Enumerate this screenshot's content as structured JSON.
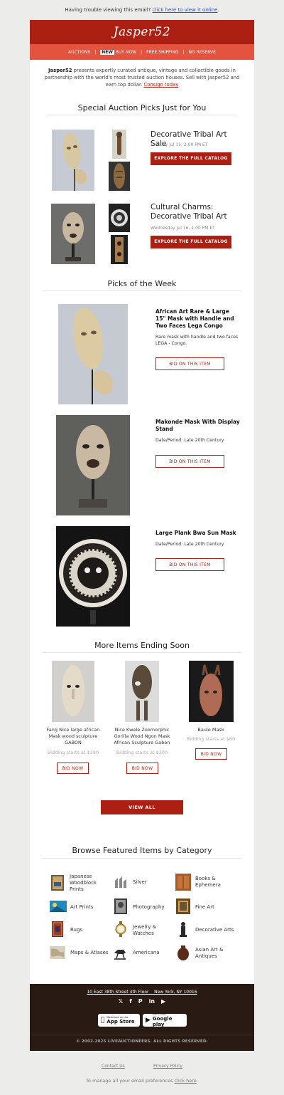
{
  "preheader": {
    "text": "Having trouble viewing this email?",
    "link": "click here to view it online",
    "end": "."
  },
  "header": {
    "logo": "Jasper52"
  },
  "nav": {
    "auctions": "AUCTIONS",
    "sep": "|",
    "new_badge": "NEW",
    "buy_now": "BUY NOW",
    "free_shipping": "FREE SHIPPING",
    "no_reserve": "NO RESERVE"
  },
  "intro": {
    "brand": "Jasper52",
    "text": " presents expertly curated antique, vintage and collectible goods in partnership with the world's most trusted auction houses. Sell with Jasper52 and earn top dollar. ",
    "link": "Consign today"
  },
  "special": {
    "heading": "Special Auction Picks Just for You",
    "sales": [
      {
        "title": "Decorative Tribal Art Sale",
        "date": "Tuesday Jul 15, 2:00 PM ET",
        "button": "EXPLORE THE FULL CATALOG"
      },
      {
        "title": "Cultural Charms: Decorative Tribal Art",
        "date": "Wednesday Jul 16, 1:00 PM ET",
        "button": "EXPLORE THE FULL CATALOG"
      }
    ]
  },
  "picks": {
    "heading": "Picks of the Week",
    "items": [
      {
        "title": "African Art Rare & Large 15\" Mask with Handle and Two Faces Lega Congo",
        "desc": "Rare mask with handle and two faces LEGA - Congo.",
        "button": "BID ON THIS ITEM"
      },
      {
        "title": "Makonde Mask With Display Stand",
        "desc": "Date/Period: Late 20th Century",
        "button": "BID ON THIS ITEM"
      },
      {
        "title": "Large Plank Bwa Sun Mask",
        "desc": "Date/Period: Late 20th Century",
        "button": "BID ON THIS ITEM"
      }
    ]
  },
  "ending": {
    "heading": "More Items Ending Soon",
    "items": [
      {
        "name": "Fang Nice large african Mask wood sculpture GABON",
        "price": "Bidding starts at $180",
        "button": "BID NOW"
      },
      {
        "name": "Nice Kwele Zoomorphic Gorilla Wood Ngon Mask African Sculpture Gabon",
        "price": "Bidding starts at $200",
        "button": "BID NOW"
      },
      {
        "name": "Baule Mask",
        "price": "Bidding starts at $60",
        "button": "BID NOW"
      }
    ],
    "view_all": "VIEW ALL"
  },
  "categories": {
    "heading": "Browse Featured Items by Category",
    "items": [
      "Japanese Woodblock Prints",
      "Silver",
      "Books & Ephemera",
      "Art Prints",
      "Photography",
      "Fine Art",
      "Rugs",
      "Jewelry & Watches",
      "Decorative Arts",
      "Maps & Atlases",
      "Americana",
      "Asian Art & Antiques"
    ]
  },
  "footer": {
    "address_1": "10 East 38th Street 4th Floor",
    "address_2": "New York, NY 10016",
    "social": [
      "twitter-icon",
      "facebook-icon",
      "pinterest-icon",
      "linkedin-icon",
      "youtube-icon"
    ],
    "appstore_small": "Download on the",
    "appstore_big": "App Store",
    "gplay_small": "GET IT ON",
    "gplay_big": "Google play",
    "copyright": "© 2002-2025 LIVEAUCTIONEERS. ALL RIGHTS RESERVED."
  },
  "bottom": {
    "contact": "Contact Us",
    "privacy": "Privacy Policy",
    "manage": "To manage all your email preferences ",
    "manage_link": "click here",
    "manage_end": "."
  },
  "colors": {
    "brand_red": "#ac1f13",
    "nav_orange": "#e3533d",
    "footer_brown": "#2a1a14"
  }
}
